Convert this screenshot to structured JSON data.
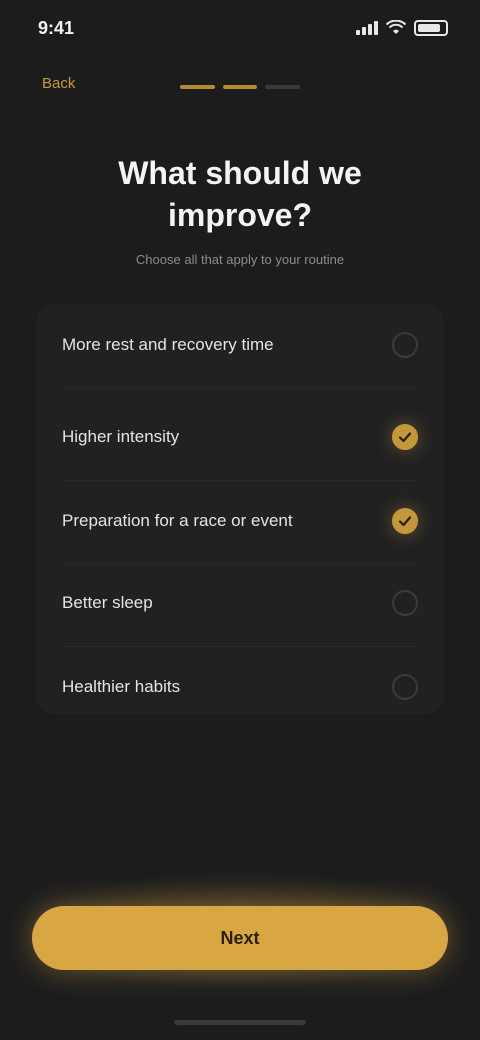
{
  "status_bar": {
    "time": "9:41"
  },
  "nav": {
    "back_label": "Back",
    "progress_steps": 3,
    "progress_current": 2
  },
  "header": {
    "title": "What should we improve?",
    "subtitle": "Choose all that apply to your routine"
  },
  "options": [
    {
      "label": "More rest and recovery time",
      "selected": false
    },
    {
      "label": "Higher intensity",
      "selected": true
    },
    {
      "label": "Preparation for a race or event",
      "selected": true
    },
    {
      "label": "Better sleep",
      "selected": false
    },
    {
      "label": "Healthier habits",
      "selected": false
    }
  ],
  "cta": {
    "label": "Next"
  },
  "colors": {
    "accent": "#d8a744",
    "background": "#1c1c1d",
    "card": "#212122"
  }
}
